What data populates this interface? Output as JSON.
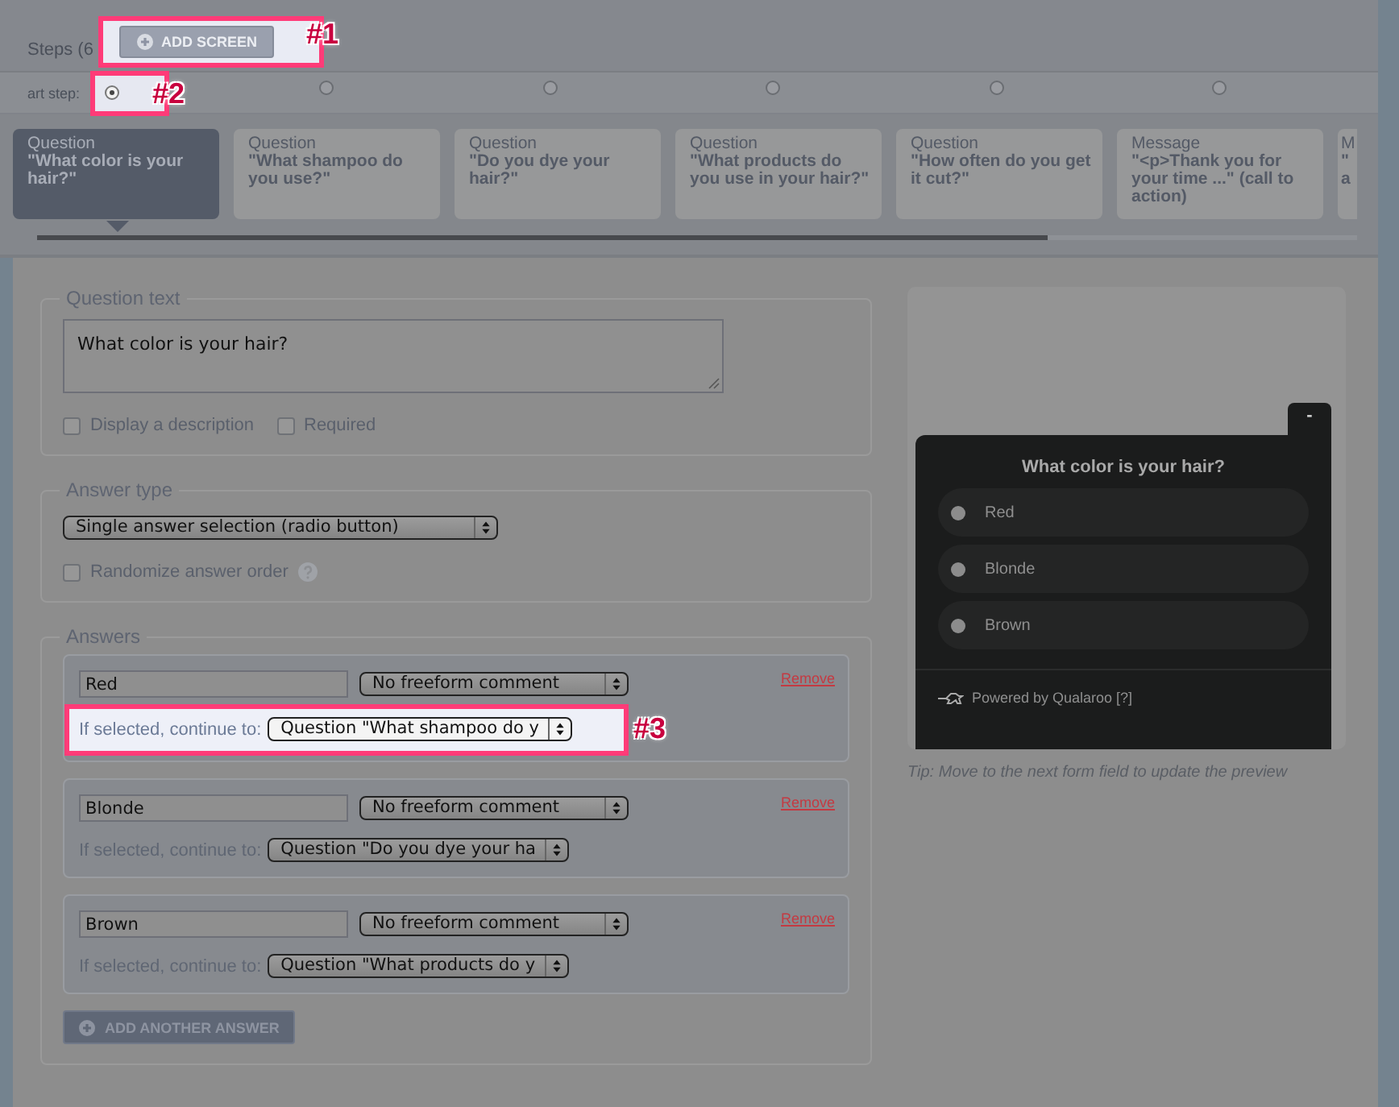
{
  "header": {
    "steps_label": "Steps (6",
    "add_screen": {
      "label": "ADD SCREEN",
      "highlighted": true,
      "callout": "#1"
    }
  },
  "start_step": {
    "label": "art step:",
    "radios": [
      {
        "selected": true,
        "highlighted": true,
        "callout": "#2"
      },
      {
        "selected": false,
        "highlighted": false
      },
      {
        "selected": false,
        "highlighted": false
      },
      {
        "selected": false,
        "highlighted": false
      },
      {
        "selected": false,
        "highlighted": false
      },
      {
        "selected": false,
        "highlighted": false
      }
    ]
  },
  "steps": [
    {
      "type": "Question",
      "text": "\"What color is your hair?\"",
      "selected": true
    },
    {
      "type": "Question",
      "text": "\"What shampoo do you use?\"",
      "selected": false
    },
    {
      "type": "Question",
      "text": "\"Do you dye your hair?\"",
      "selected": false
    },
    {
      "type": "Question",
      "text": "\"What products do you use in your hair?\"",
      "selected": false
    },
    {
      "type": "Question",
      "text": "\"How often do you get it cut?\"",
      "selected": false
    },
    {
      "type": "Message",
      "text": "\"<p>Thank you for your time ...\" (call to action)",
      "selected": false
    },
    {
      "type": "M",
      "text": "\" a",
      "selected": false
    }
  ],
  "question_text": {
    "legend": "Question text",
    "value": "What color is your hair?",
    "options": [
      {
        "label": "Display a description",
        "checked": false
      },
      {
        "label": "Required",
        "checked": false
      }
    ]
  },
  "answer_type": {
    "legend": "Answer type",
    "value": "Single answer selection (radio button)",
    "randomize": {
      "label": "Randomize answer order",
      "checked": false
    }
  },
  "answers": {
    "legend": "Answers",
    "items": [
      {
        "value": "Red",
        "comment": "No freeform comment",
        "remove": "Remove",
        "continue_label": "If selected, continue to:",
        "continue_value": "Question \"What shampoo do y",
        "highlighted": true,
        "callout": "#3"
      },
      {
        "value": "Blonde",
        "comment": "No freeform comment",
        "remove": "Remove",
        "continue_label": "If selected, continue to:",
        "continue_value": "Question \"Do you dye your ha",
        "highlighted": false
      },
      {
        "value": "Brown",
        "comment": "No freeform comment",
        "remove": "Remove",
        "continue_label": "If selected, continue to:",
        "continue_value": "Question \"What products do y",
        "highlighted": false
      }
    ],
    "add_button": "ADD ANOTHER ANSWER"
  },
  "preview": {
    "minimize": "-",
    "question": "What color is your hair?",
    "options": [
      {
        "label": "Red",
        "selected": false
      },
      {
        "label": "Blonde",
        "selected": false
      },
      {
        "label": "Brown",
        "selected": false
      }
    ],
    "powered_by": "Powered by Qualaroo [?]",
    "tip": "Tip: Move to the next form field to update the preview"
  }
}
